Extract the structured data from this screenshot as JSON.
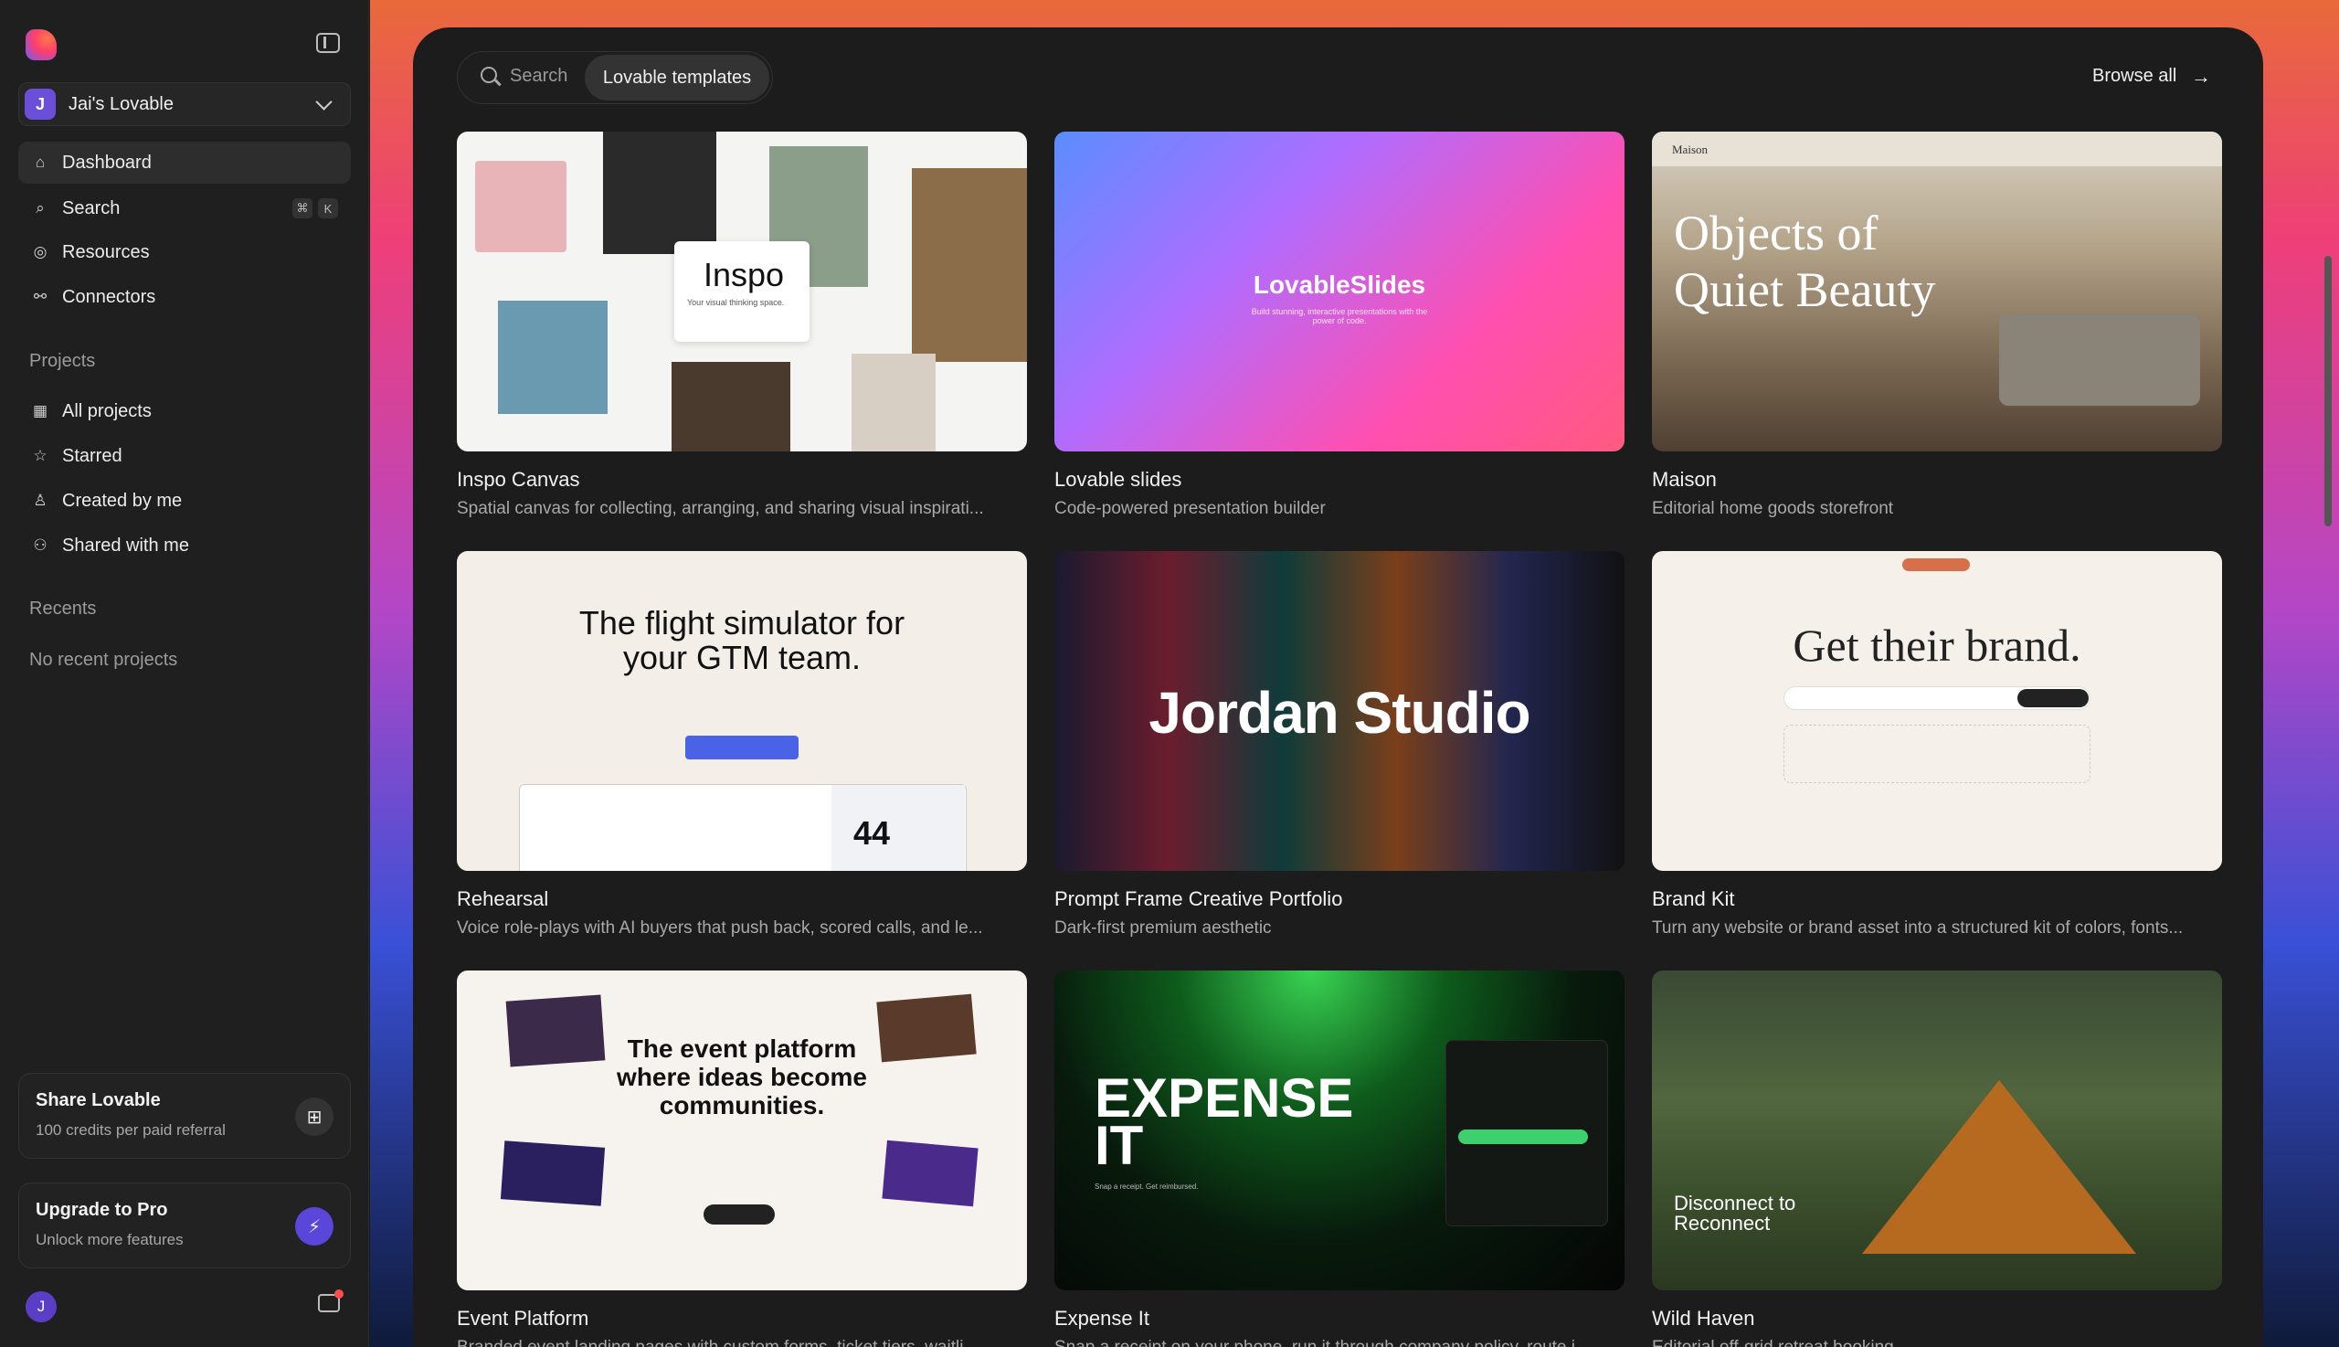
{
  "sidebar": {
    "workspace": {
      "initial": "J",
      "name": "Jai's Lovable"
    },
    "nav": [
      {
        "label": "Dashboard",
        "icon": "home-icon"
      },
      {
        "label": "Search",
        "icon": "search-icon",
        "shortcut": [
          "⌘",
          "K"
        ]
      },
      {
        "label": "Resources",
        "icon": "compass-icon"
      },
      {
        "label": "Connectors",
        "icon": "connectors-icon"
      }
    ],
    "projects_label": "Projects",
    "projects": [
      {
        "label": "All projects",
        "icon": "grid-icon"
      },
      {
        "label": "Starred",
        "icon": "star-icon"
      },
      {
        "label": "Created by me",
        "icon": "user-icon"
      },
      {
        "label": "Shared with me",
        "icon": "users-icon"
      }
    ],
    "recents_label": "Recents",
    "recents_empty": "No recent projects",
    "share": {
      "title": "Share Lovable",
      "subtitle": "100 credits per paid referral"
    },
    "upgrade": {
      "title": "Upgrade to Pro",
      "subtitle": "Unlock more features"
    },
    "user_initial": "J"
  },
  "toolbar": {
    "search_label": "Search",
    "active_chip": "Lovable templates",
    "browse_all": "Browse all"
  },
  "templates": [
    {
      "title": "Inspo Canvas",
      "desc": "Spatial canvas for collecting, arranging, and sharing visual inspirati...",
      "preview_text": "Inspo",
      "preview_sub": "Your visual thinking space."
    },
    {
      "title": "Lovable slides",
      "desc": "Code-powered presentation builder",
      "preview_text": "LovableSlides",
      "preview_sub": "Build stunning, interactive presentations with the power of code."
    },
    {
      "title": "Maison",
      "desc": "Editorial home goods storefront",
      "preview_text": "Objects of Quiet Beauty",
      "preview_sub": "Maison"
    },
    {
      "title": "Rehearsal",
      "desc": "Voice role-plays with AI buyers that push back, scored calls, and le...",
      "preview_text": "The flight simulator for your GTM team.",
      "preview_sub": "44"
    },
    {
      "title": "Prompt Frame Creative Portfolio",
      "desc": "Dark-first premium aesthetic",
      "preview_text": "Jordan Studio",
      "preview_sub": ""
    },
    {
      "title": "Brand Kit",
      "desc": "Turn any website or brand asset into a structured kit of colors, fonts...",
      "preview_text": "Get their brand.",
      "preview_sub": ""
    },
    {
      "title": "Event Platform",
      "desc": "Branded event landing pages with custom forms, ticket tiers, waitli...",
      "preview_text": "The event platform where ideas become communities.",
      "preview_sub": ""
    },
    {
      "title": "Expense It",
      "desc": "Snap a receipt on your phone, run it through company policy, route i...",
      "preview_text": "EXPENSE IT",
      "preview_sub": "Snap a receipt. Get reimbursed."
    },
    {
      "title": "Wild Haven",
      "desc": "Editorial off-grid retreat booking",
      "preview_text": "Disconnect to Reconnect",
      "preview_sub": ""
    }
  ]
}
